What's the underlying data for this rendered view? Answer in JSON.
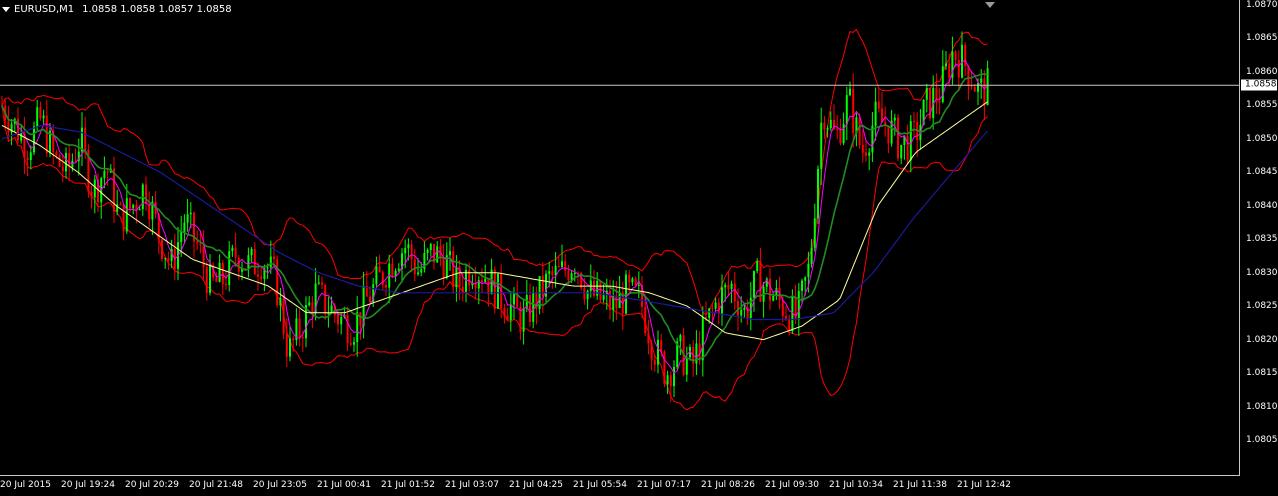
{
  "header": {
    "symbol": "EURUSD,M1",
    "ohlc": "1.0858 1.0858 1.0857 1.0858"
  },
  "price_tag": "1.0858",
  "colors": {
    "background": "#000000",
    "bull_candle": "#00ff00",
    "bear_candle": "#ff0000",
    "bollinger": "#ff0000",
    "ma_fast": "#ff00ff",
    "ma_mid": "#228b22",
    "ma_slow": "#ffff99",
    "ma_long": "#1a1a9c",
    "price_line": "#c8c8c8"
  },
  "icons": {
    "menu": "dropdown-triangle-icon",
    "shift": "chart-shift-marker-icon"
  },
  "chart_data": {
    "type": "line",
    "symbol": "EURUSD",
    "timeframe": "M1",
    "x_tick_labels": [
      "20 Jul 2015",
      "20 Jul 19:24",
      "20 Jul 20:29",
      "20 Jul 21:48",
      "20 Jul 23:05",
      "21 Jul 00:41",
      "21 Jul 01:52",
      "21 Jul 03:07",
      "21 Jul 04:25",
      "21 Jul 05:54",
      "21 Jul 07:17",
      "21 Jul 08:26",
      "21 Jul 09:30",
      "21 Jul 10:34",
      "21 Jul 11:38",
      "21 Jul 12:42"
    ],
    "y_tick_labels": [
      "1.0870",
      "1.0865",
      "1.0860",
      "1.0855",
      "1.0850",
      "1.0845",
      "1.0840",
      "1.0835",
      "1.0830",
      "1.0825",
      "1.0820",
      "1.0815",
      "1.0810",
      "1.0805"
    ],
    "ylim": [
      1.0803,
      1.087
    ],
    "current_price": 1.0858,
    "price_path": [
      1.0855,
      1.0852,
      1.0849,
      1.0853,
      1.0847,
      1.0845,
      1.085,
      1.0842,
      1.0846,
      1.0838,
      1.084,
      1.0843,
      1.0836,
      1.0831,
      1.0838,
      1.0834,
      1.0828,
      1.0829,
      1.0833,
      1.0831,
      1.0832,
      1.0829,
      1.0818,
      1.0822,
      1.0827,
      1.0825,
      1.0823,
      1.0822,
      1.0826,
      1.0829,
      1.0832,
      1.0834,
      1.083,
      1.0833,
      1.0832,
      1.0828,
      1.0831,
      1.083,
      1.0827,
      1.0825,
      1.0823,
      1.0826,
      1.0829,
      1.083,
      1.0832,
      1.0827,
      1.0826,
      1.0825,
      1.0827,
      1.0826,
      1.0819,
      1.0815,
      1.0818,
      1.0816,
      1.0822,
      1.0826,
      1.0828,
      1.0824,
      1.0829,
      1.0827,
      1.0825,
      1.0823,
      1.0831,
      1.0855,
      1.085,
      1.0856,
      1.0848,
      1.0853,
      1.0852,
      1.0849,
      1.085,
      1.0855,
      1.0857,
      1.0863,
      1.0861,
      1.0857,
      1.0858
    ],
    "ma_long_path": [
      1.085,
      1.0852,
      1.0851,
      1.0848,
      1.0845,
      1.0841,
      1.0837,
      1.0833,
      1.083,
      1.0828,
      1.0827,
      1.0827,
      1.0827,
      1.0827,
      1.0827,
      1.0827,
      1.0826,
      1.0825,
      1.0824,
      1.0823,
      1.0823,
      1.0824,
      1.083,
      1.0838,
      1.0845,
      1.0852
    ],
    "ma_slow_path": [
      1.0852,
      1.0849,
      1.0845,
      1.084,
      1.0836,
      1.0832,
      1.083,
      1.0828,
      1.0824,
      1.0824,
      1.0826,
      1.0828,
      1.083,
      1.083,
      1.0829,
      1.0828,
      1.0828,
      1.0827,
      1.0825,
      1.0821,
      1.082,
      1.0822,
      1.0826,
      1.084,
      1.0848,
      1.0852,
      1.0856
    ]
  }
}
